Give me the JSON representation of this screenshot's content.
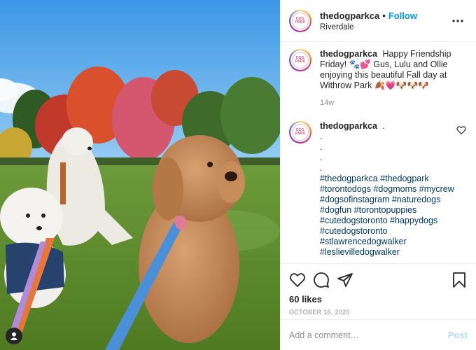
{
  "header": {
    "username": "thedogparkca",
    "dot": "•",
    "follow_label": "Follow",
    "location": "Riverdale",
    "avatar_text": "DOG PARK"
  },
  "caption": {
    "username": "thedogparkca",
    "text": "Happy Friendship Friday! 🐾💕 Gus, Lulu and Ollie enjoying this beautiful Fall day at Withrow Park 🍂💗🐶🐶🐶",
    "time": "14w"
  },
  "comment": {
    "username": "thedogparkca",
    "text": ".",
    "dots": [
      ".",
      ".",
      ".",
      "."
    ],
    "hashtag_lines": [
      "#thedogparkca #thedogpark",
      "#torontodogs #dogmoms #mycrew",
      "#dogsofinstagram #naturedogs",
      "#dogfun #torontopuppies",
      "#cutedogstoronto #happydogs",
      "#cutedogstoronto",
      "#stlawrencedogwalker",
      "#leslievilledogwalker"
    ]
  },
  "actions": {
    "likes": "60 likes",
    "date": "OCTOBER 16, 2020"
  },
  "add_comment": {
    "placeholder": "Add a comment…",
    "post_label": "Post"
  },
  "icons": [
    "more-icon",
    "heart-icon",
    "comment-icon",
    "share-icon",
    "save-icon",
    "small-heart-icon",
    "user-tag-icon"
  ],
  "colors": {
    "accent": "#0095f6",
    "post_disabled": "#b2dffc",
    "hashtag": "#00376b",
    "muted": "#8e8e8e"
  }
}
